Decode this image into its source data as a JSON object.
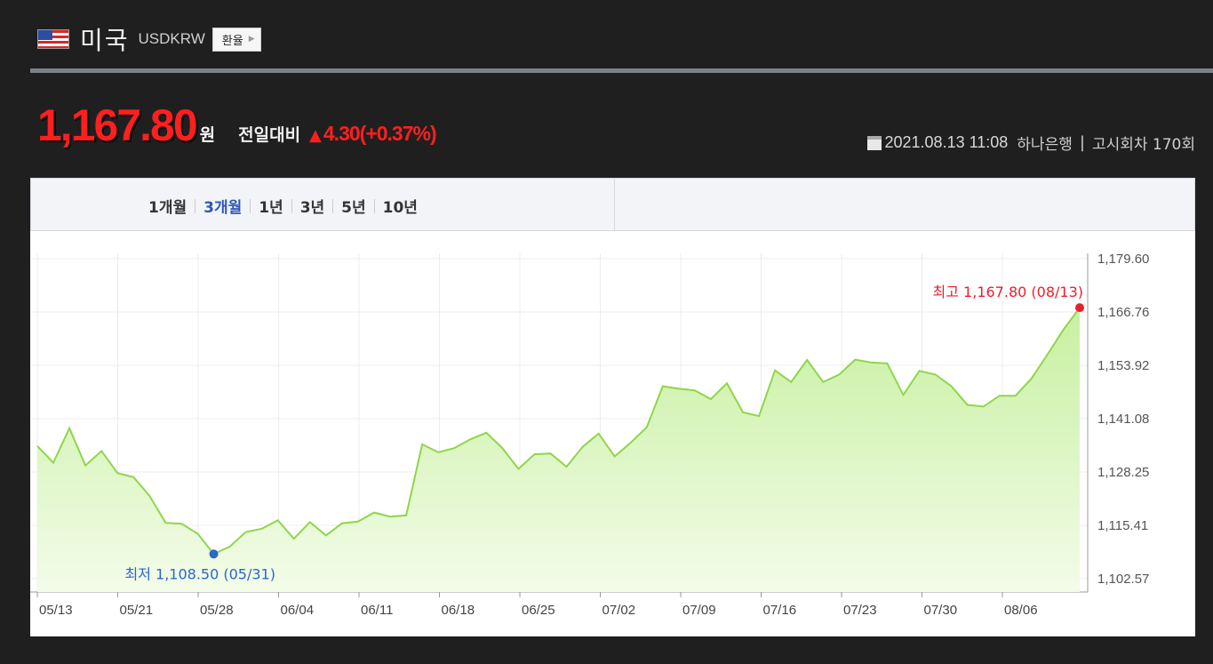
{
  "header": {
    "flag_icon": "us-flag-icon",
    "country": "미국",
    "code": "USDKRW",
    "exchange_button": "환율"
  },
  "price": {
    "value": "1,167.80",
    "unit": "원",
    "compare_label": "전일대비",
    "change": "4.30",
    "change_pct": "(+0.37%)",
    "up_color": "#ff1f1f"
  },
  "info": {
    "datetime": "2021.08.13 11:08",
    "bank": "하나은행",
    "separator": "|",
    "round": "고시회차 170회"
  },
  "tabs": [
    {
      "label": "1개월",
      "active": false
    },
    {
      "label": "3개월",
      "active": true
    },
    {
      "label": "1년",
      "active": false
    },
    {
      "label": "3년",
      "active": false
    },
    {
      "label": "5년",
      "active": false
    },
    {
      "label": "10년",
      "active": false
    }
  ],
  "chart_data": {
    "type": "area",
    "x_tick_labels": [
      "05/13",
      "05/21",
      "05/28",
      "06/04",
      "06/11",
      "06/18",
      "06/25",
      "07/02",
      "07/09",
      "07/16",
      "07/23",
      "07/30",
      "08/06"
    ],
    "y_tick_labels": [
      "1,179.60",
      "1,166.76",
      "1,153.92",
      "1,141.08",
      "1,128.25",
      "1,115.41",
      "1,102.57"
    ],
    "ylim": [
      1102.57,
      1179.6
    ],
    "values": [
      1134.5,
      1130.5,
      1138.8,
      1129.8,
      1133.3,
      1128.0,
      1127.0,
      1122.5,
      1116.0,
      1115.8,
      1113.4,
      1108.5,
      1110.3,
      1113.8,
      1114.6,
      1116.6,
      1112.2,
      1116.2,
      1113.0,
      1115.9,
      1116.3,
      1118.5,
      1117.5,
      1117.8,
      1134.9,
      1133.0,
      1134.0,
      1136.1,
      1137.7,
      1134.0,
      1129.0,
      1132.5,
      1132.7,
      1129.5,
      1134.3,
      1137.5,
      1132.0,
      1135.3,
      1139.0,
      1148.9,
      1148.3,
      1147.9,
      1145.8,
      1149.6,
      1142.6,
      1141.7,
      1152.7,
      1149.9,
      1155.2,
      1149.9,
      1151.7,
      1155.3,
      1154.6,
      1154.4,
      1146.8,
      1152.6,
      1151.7,
      1148.9,
      1144.4,
      1144.0,
      1146.6,
      1146.6,
      1150.8,
      1156.6,
      1162.6,
      1167.8
    ],
    "high": {
      "label": "최고 1,167.80 (08/13)",
      "value": 1167.8,
      "index": 65
    },
    "low": {
      "label": "최저 1,108.50 (05/31)",
      "value": 1108.5,
      "index": 11
    },
    "line_color": "#8fd64a",
    "fill_color_top": "#c7f0a0",
    "fill_color_bottom": "#f3fce9",
    "high_color": "#e8202a",
    "low_color": "#2a67c9",
    "grid": true
  }
}
